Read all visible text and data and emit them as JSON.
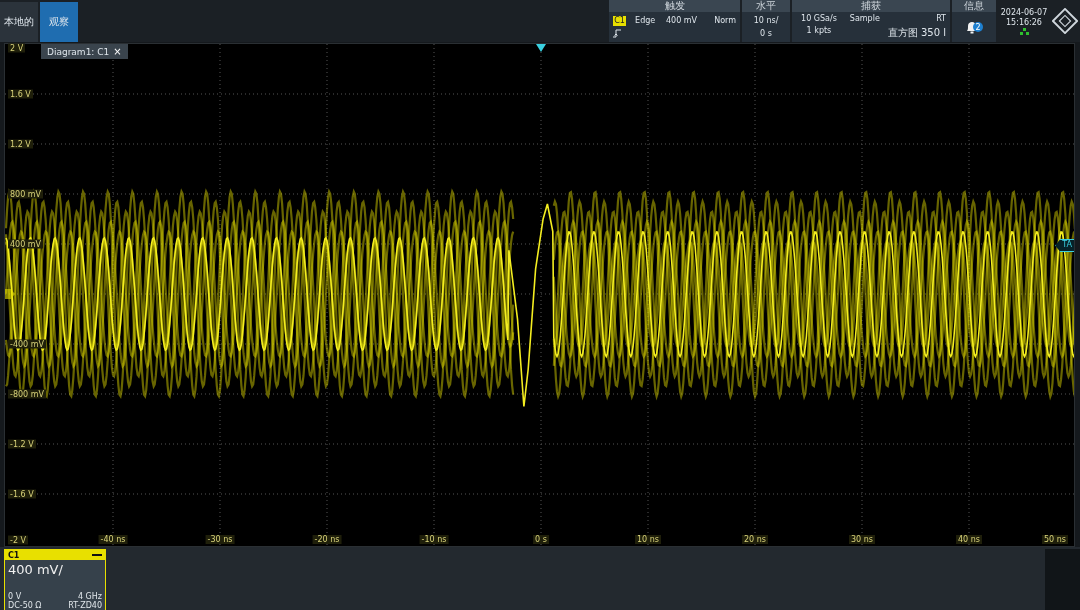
{
  "tabs": [
    {
      "label": "本地的",
      "selected": false
    },
    {
      "label": "观察",
      "selected": true
    }
  ],
  "trigger": {
    "title": "触发",
    "source": "C1",
    "type": "Edge",
    "level": "400 mV",
    "mode": "Norm"
  },
  "horizontal": {
    "title": "水平",
    "scale": "10 ns/",
    "position": "0 s"
  },
  "acquisition": {
    "title": "捕获",
    "rate": "10 GSa/s",
    "mode": "Sample",
    "rt": "RT",
    "length": "1 kpts",
    "histogram": "直方图 350 l"
  },
  "info": {
    "title": "信息",
    "count": "2"
  },
  "clock": {
    "date": "2024-06-07",
    "time": "15:16:26"
  },
  "diagram": {
    "tab": "Diagram1: C1",
    "close": "×"
  },
  "y_labels": [
    "2 V",
    "1.6 V",
    "1.2 V",
    "800 mV",
    "400 mV",
    "-400 mV",
    "-800 mV",
    "-1.2 V",
    "-1.6 V",
    "-2 V"
  ],
  "x_labels": [
    "-40 ns",
    "-30 ns",
    "-20 ns",
    "-10 ns",
    "0 s",
    "10 ns",
    "20 ns",
    "30 ns",
    "40 ns",
    "50 ns"
  ],
  "markers": {
    "trigger_time": "TA"
  },
  "channel": {
    "name": "C1",
    "scale": "400 mV/",
    "offset": "0 V",
    "bandwidth": "4 GHz",
    "coupling": "DC-50 Ω",
    "probe": "RT-ZD40"
  }
}
